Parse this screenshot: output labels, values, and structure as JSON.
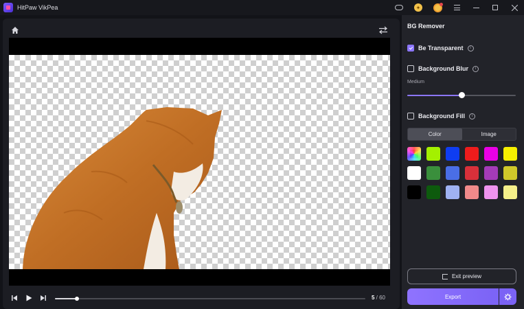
{
  "app": {
    "title": "HitPaw VikPea"
  },
  "titlebar": {
    "icons": [
      "gamepad-icon",
      "coin-icon",
      "avatar-icon",
      "menu-icon",
      "minimize-icon",
      "maximize-icon",
      "close-icon"
    ]
  },
  "preview": {
    "icons": {
      "home": "home-icon",
      "swap": "swap-icon"
    },
    "playback": {
      "current_frame": "5",
      "separator": " / ",
      "total_frames": "60",
      "progress_fraction": 0.07
    }
  },
  "panel": {
    "title": "BG Remover",
    "options": [
      {
        "label": "Be Transparent",
        "checked": true
      },
      {
        "label": "Background Blur",
        "checked": false
      },
      {
        "label": "Background Fill",
        "checked": false
      }
    ],
    "blur": {
      "level_label": "Medium",
      "level_fraction": 0.5
    },
    "fill_tabs": [
      {
        "label": "Color",
        "active": true
      },
      {
        "label": "Image",
        "active": false
      }
    ],
    "colors": [
      "rainbow",
      "#a4f000",
      "#0f3df2",
      "#ee1c1c",
      "#ea00e6",
      "#f6f000",
      "#ffffff",
      "#3a8f3c",
      "#4a6ee6",
      "#d9303a",
      "#a43bb8",
      "#cfc82a",
      "#000000",
      "#0d5a0d",
      "#9fb2f2",
      "#f08a8a",
      "#ee93ee",
      "#f5f08a"
    ],
    "exit_label": "Exit preview",
    "export_label": "Export"
  }
}
